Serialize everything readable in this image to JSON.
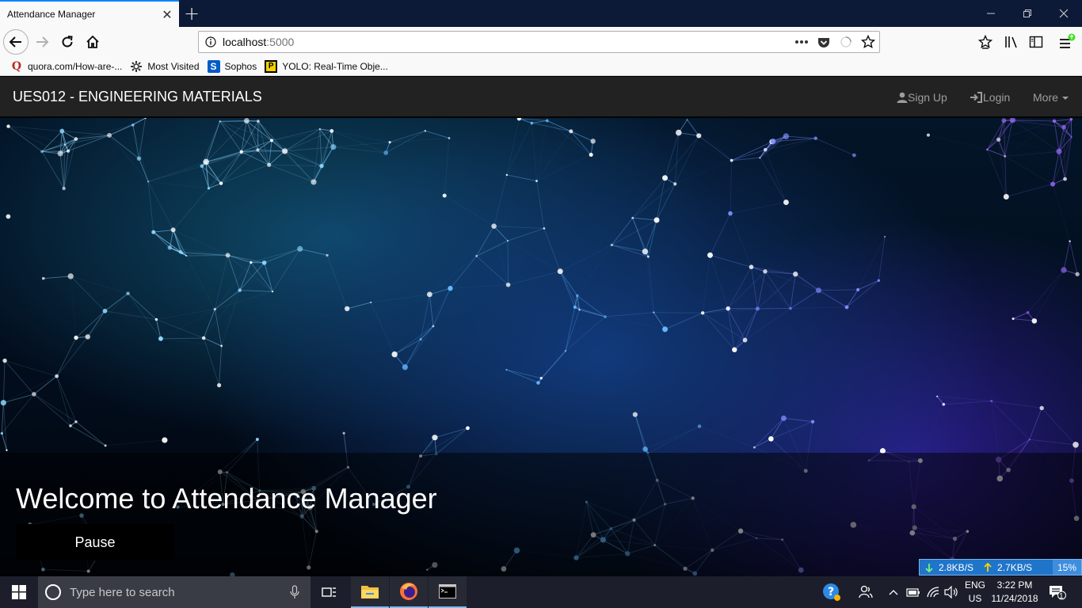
{
  "browser": {
    "tab_title": "Attendance Manager",
    "tab_close": "✕",
    "new_tab": "+",
    "url_host": "localhost",
    "url_port": ":5000",
    "url_actions": [
      "page-actions-icon",
      "pocket-icon",
      "reader-icon",
      "star-icon"
    ],
    "bookmarks": [
      {
        "label": "quora.com/How-are-...",
        "icon": "quora-icon"
      },
      {
        "label": "Most Visited",
        "icon": "gear-icon"
      },
      {
        "label": "Sophos",
        "icon": "sophos-icon"
      },
      {
        "label": "YOLO: Real-Time Obje...",
        "icon": "yolo-icon"
      }
    ]
  },
  "site": {
    "brand": "UES012 - ENGINEERING MATERIALS",
    "nav": {
      "signup": "Sign Up",
      "login": "Login",
      "more": "More"
    },
    "hero": {
      "title": "Welcome to Attendance Manager",
      "pause_label": "Pause"
    }
  },
  "netspeed": {
    "down": "2.8KB/S",
    "up": "2.7KB/S",
    "cpu": "15%"
  },
  "taskbar": {
    "search_placeholder": "Type here to search",
    "lang_line1": "ENG",
    "lang_line2": "US",
    "time": "3:22 PM",
    "date": "11/24/2018",
    "notification_count": "1"
  },
  "colors": {
    "nav_bg": "#222222",
    "accent": "#0a84ff",
    "taskbar_bg": "#1c1f2b",
    "netspeed_bg": "#1f75c9"
  }
}
